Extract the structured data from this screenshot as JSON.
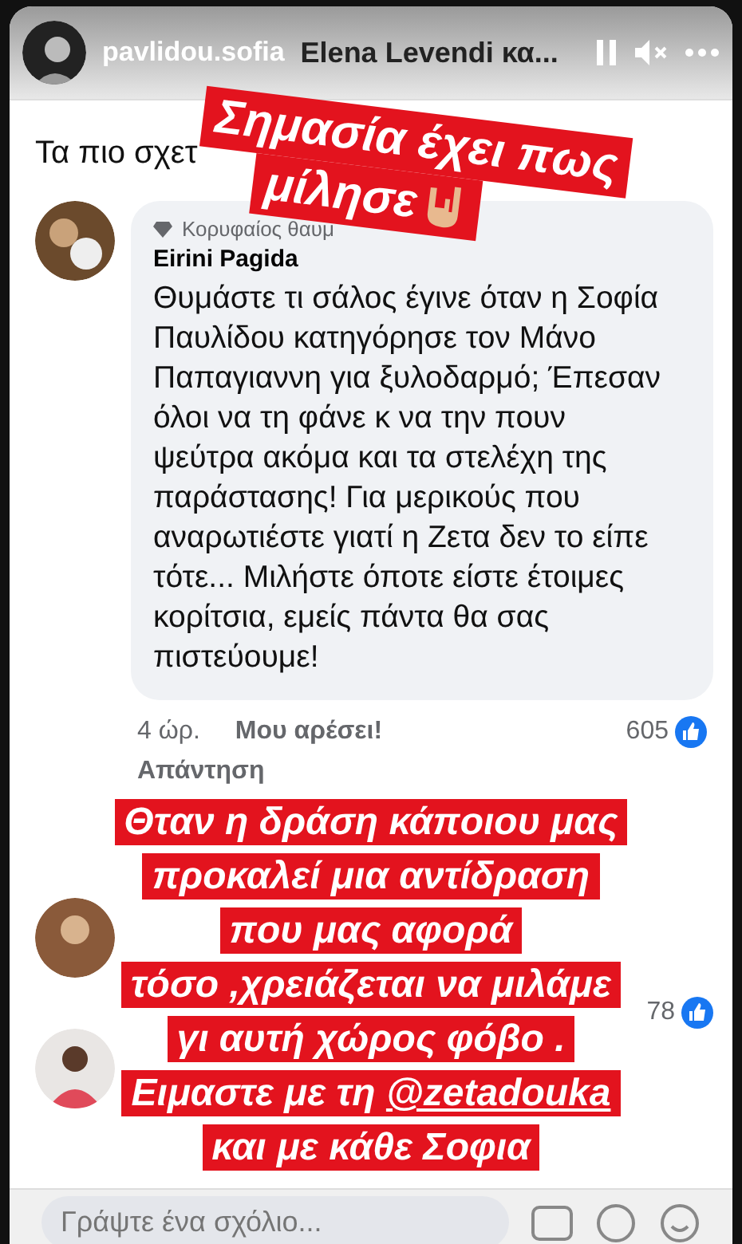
{
  "story": {
    "username": "pavlidou.sofia"
  },
  "post_header": {
    "title": "Elena Levendi κα..."
  },
  "section_heading": "Τα πιο σχετ",
  "comments": [
    {
      "badge": "Κορυφαίος θαυμ",
      "author": "Eirini Pagida",
      "text": "Θυμάστε τι σάλος έγινε όταν η Σοφία Παυλίδου κατηγόρησε τον Μάνο Παπαγιαννη για ξυλοδαρμό; Έπεσαν όλοι να τη φάνε κ να την πουν ψεύτρα ακόμα και τα στελέχη της παράστασης! Για μερικούς που αναρωτιέστε γιατί η Ζετα δεν το είπε τότε... Μιλήστε όποτε είστε έτοιμες κορίτσια, εμείς πάντα θα σας πιστεύουμε!",
      "time": "4 ώρ.",
      "like": "Μου αρέσει!",
      "reply": "Απάντηση",
      "reactions": "605"
    },
    {
      "reactions": "78"
    }
  ],
  "composer": {
    "placeholder": "Γράψτε ένα σχόλιο..."
  },
  "sticker": {
    "lines": [
      "Σημασία έχει πως",
      "μίλησε"
    ]
  },
  "captions": [
    {
      "text": "Θταν η δράση κάποιου μας"
    },
    {
      "text": "προκαλεί μια αντίδραση"
    },
    {
      "text": "που μας αφορά"
    },
    {
      "text": "τόσο ,χρειάζεται να μιλάμε"
    },
    {
      "text": "γι αυτή χώρος φόβο ."
    },
    {
      "text": "Ειμαστε με τη ",
      "mention": "@zetadouka"
    },
    {
      "text": "και με κάθε Σοφια"
    }
  ]
}
